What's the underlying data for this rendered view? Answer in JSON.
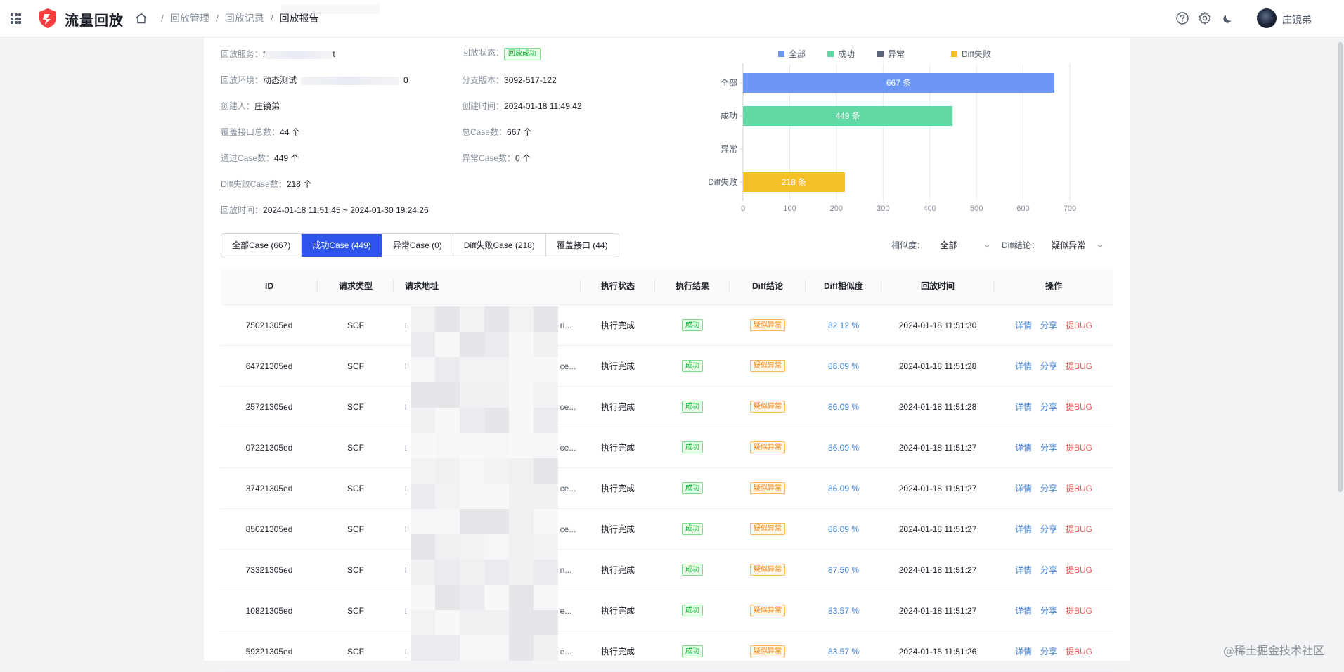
{
  "app": {
    "brand": "流量回放"
  },
  "breadcrumb": [
    "回放管理",
    "回放记录",
    "回放报告"
  ],
  "user": {
    "name": "庄镜弟"
  },
  "info": {
    "service": {
      "label": "回放服务：",
      "prefix": "f",
      "suffix": "t"
    },
    "status": {
      "label": "回放状态：",
      "value": "回放成功"
    },
    "env": {
      "label": "回放环境：",
      "value": "动态测试",
      "suffix": "0"
    },
    "branch": {
      "label": "分支版本：",
      "value": "3092-517-122"
    },
    "creator": {
      "label": "创建人：",
      "value": "庄镜弟"
    },
    "created": {
      "label": "创建时间：",
      "value": "2024-01-18 11:49:42"
    },
    "apis": {
      "label": "覆盖接口总数：",
      "value": "44 个"
    },
    "total": {
      "label": "总Case数：",
      "value": "667 个"
    },
    "passed": {
      "label": "通过Case数：",
      "value": "449 个"
    },
    "abnormal": {
      "label": "异常Case数：",
      "value": "0 个"
    },
    "difffail": {
      "label": "Diff失败Case数：",
      "value": "218 个"
    },
    "time": {
      "label": "回放时间：",
      "value": "2024-01-18 11:51:45 ~ 2024-01-30 19:24:26"
    }
  },
  "chart_data": {
    "type": "bar",
    "orientation": "horizontal",
    "categories": [
      "全部",
      "成功",
      "异常",
      "Diff失败"
    ],
    "values": [
      667,
      449,
      0,
      218
    ],
    "data_labels": [
      "667 条",
      "449 条",
      "",
      "218 条"
    ],
    "colors": [
      "#6c97f7",
      "#62d8a4",
      "#5b6678",
      "#f5bf27"
    ],
    "legend": [
      "全部",
      "成功",
      "异常",
      "Diff失败"
    ],
    "legend_position": "top",
    "xlim": [
      0,
      700
    ],
    "xticks": [
      0,
      100,
      200,
      300,
      400,
      500,
      600,
      700
    ],
    "grid": true
  },
  "tabs": [
    {
      "label": "全部Case (667)",
      "active": false
    },
    {
      "label": "成功Case (449)",
      "active": true
    },
    {
      "label": "异常Case (0)",
      "active": false
    },
    {
      "label": "Diff失败Case (218)",
      "active": false
    },
    {
      "label": "覆盖接口 (44)",
      "active": false
    }
  ],
  "filters": {
    "similarity": {
      "label": "相似度：",
      "value": "全部"
    },
    "diff": {
      "label": "Diff结论：",
      "value": "疑似异常"
    }
  },
  "table": {
    "columns": [
      "ID",
      "请求类型",
      "请求地址",
      "执行状态",
      "执行结果",
      "Diff结论",
      "Diff相似度",
      "回放时间",
      "操作"
    ],
    "actions": [
      "详情",
      "分享",
      "提BUG"
    ],
    "rows": [
      {
        "id": "75021305ed",
        "type": "SCF",
        "url_start": "l",
        "url_end": "ri...",
        "exec": "执行完成",
        "result": "成功",
        "diff": "疑似异常",
        "sim": "82.12 %",
        "time": "2024-01-18 11:51:30"
      },
      {
        "id": "64721305ed",
        "type": "SCF",
        "url_start": "l",
        "url_end": "ce...",
        "exec": "执行完成",
        "result": "成功",
        "diff": "疑似异常",
        "sim": "86.09 %",
        "time": "2024-01-18 11:51:28"
      },
      {
        "id": "25721305ed",
        "type": "SCF",
        "url_start": "l",
        "url_end": "ce...",
        "exec": "执行完成",
        "result": "成功",
        "diff": "疑似异常",
        "sim": "86.09 %",
        "time": "2024-01-18 11:51:28"
      },
      {
        "id": "07221305ed",
        "type": "SCF",
        "url_start": "l",
        "url_end": "ce...",
        "exec": "执行完成",
        "result": "成功",
        "diff": "疑似异常",
        "sim": "86.09 %",
        "time": "2024-01-18 11:51:27"
      },
      {
        "id": "37421305ed",
        "type": "SCF",
        "url_start": "l",
        "url_end": "ce...",
        "exec": "执行完成",
        "result": "成功",
        "diff": "疑似异常",
        "sim": "86.09 %",
        "time": "2024-01-18 11:51:27"
      },
      {
        "id": "85021305ed",
        "type": "SCF",
        "url_start": "l",
        "url_end": "ce...",
        "exec": "执行完成",
        "result": "成功",
        "diff": "疑似异常",
        "sim": "86.09 %",
        "time": "2024-01-18 11:51:27"
      },
      {
        "id": "73321305ed",
        "type": "SCF",
        "url_start": "l",
        "url_end": "n...",
        "exec": "执行完成",
        "result": "成功",
        "diff": "疑似异常",
        "sim": "87.50 %",
        "time": "2024-01-18 11:51:27"
      },
      {
        "id": "10821305ed",
        "type": "SCF",
        "url_start": "l",
        "url_end": "e...",
        "exec": "执行完成",
        "result": "成功",
        "diff": "疑似异常",
        "sim": "83.57 %",
        "time": "2024-01-18 11:51:27"
      },
      {
        "id": "59321305ed",
        "type": "SCF",
        "url_start": "l",
        "url_end": "e...",
        "exec": "执行完成",
        "result": "成功",
        "diff": "疑似异常",
        "sim": "83.57 %",
        "time": "2024-01-18 11:51:26"
      }
    ]
  },
  "watermark": "@稀土掘金技术社区"
}
